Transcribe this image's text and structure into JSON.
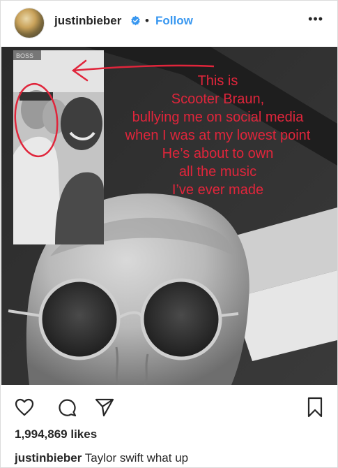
{
  "post": {
    "username": "justinbieber",
    "follow_label": "Follow",
    "more_label": "•••",
    "overlay_lines": [
      "This is",
      "Scooter Braun,",
      "bullying me on social media",
      "when I was at my lowest point",
      "He’s about to own",
      "all the music",
      "I’ve ever made"
    ],
    "inset_label": "BOSS",
    "likes": "1,994,869 likes",
    "caption_user": "justinbieber",
    "caption_text": "Taylor swift what up"
  },
  "icons": {
    "verified": "verified-badge-icon",
    "like": "heart-icon",
    "comment": "comment-icon",
    "share": "paper-plane-icon",
    "save": "bookmark-icon"
  },
  "colors": {
    "follow": "#3897f0",
    "verified": "#3897f0",
    "annotation": "#e0253b"
  }
}
